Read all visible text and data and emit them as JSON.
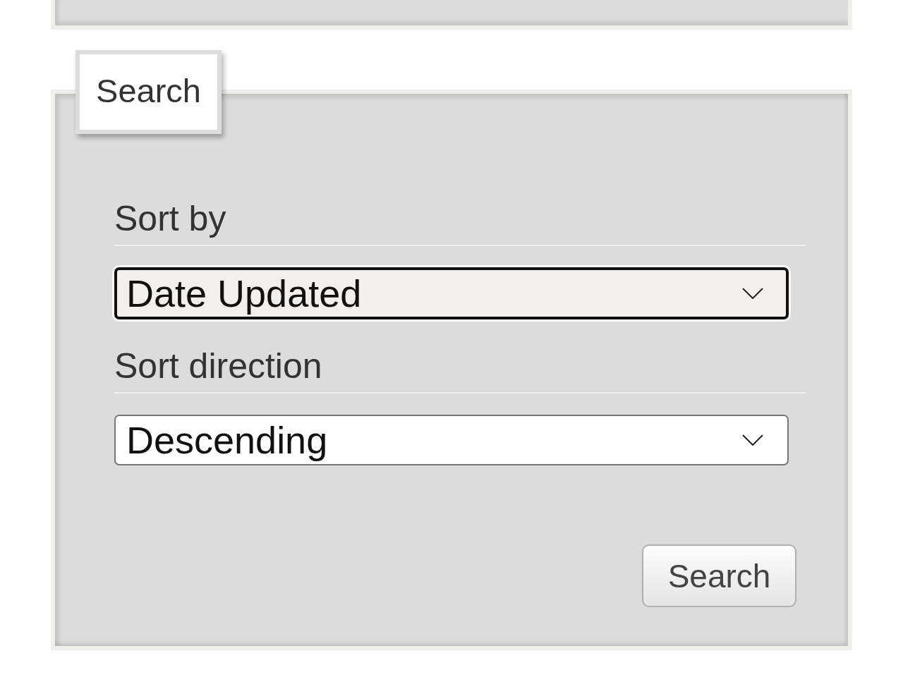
{
  "search_panel": {
    "legend": "Search",
    "fields": [
      {
        "label": "Sort by",
        "value": "Date Updated",
        "focused": true
      },
      {
        "label": "Sort direction",
        "value": "Descending",
        "focused": false
      }
    ],
    "button": "Search"
  }
}
